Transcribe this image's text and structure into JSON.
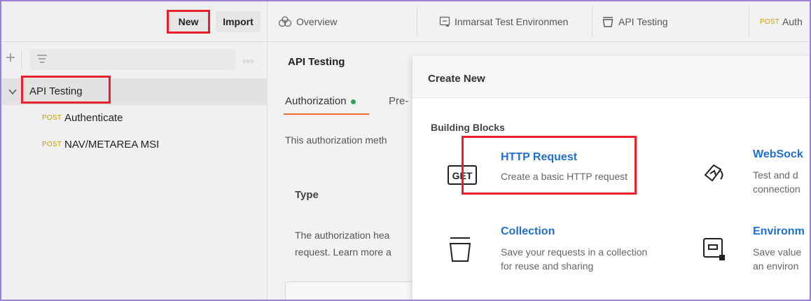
{
  "sidebar": {
    "new_label": "New",
    "import_label": "Import",
    "collection": "API Testing",
    "requests": [
      {
        "method": "POST",
        "name": "Authenticate"
      },
      {
        "method": "POST",
        "name": "NAV/METAREA MSI"
      }
    ]
  },
  "tabs": [
    {
      "label": "Overview",
      "icon": "overview-icon"
    },
    {
      "label": "Inmarsat Test Environmen",
      "icon": "environment-icon"
    },
    {
      "label": "API Testing",
      "icon": "collection-icon"
    },
    {
      "method": "POST",
      "label": "Auth"
    }
  ],
  "main": {
    "title": "API Testing",
    "auth_tab": "Authorization",
    "pre_tab": "Pre-",
    "auth_desc": "This authorization meth",
    "type_label": "Type",
    "auth_header_line1": "The authorization hea",
    "auth_header_line2": "request. Learn more a"
  },
  "modal": {
    "title": "Create New",
    "section": "Building Blocks",
    "blocks": [
      {
        "title": "HTTP Request",
        "desc1": "Create a basic HTTP request",
        "desc2": "",
        "icon": "get-icon",
        "icon_text": "GET"
      },
      {
        "title": "WebSock",
        "desc1": "Test and d",
        "desc2": "connection",
        "icon": "websocket-icon"
      },
      {
        "title": "Collection",
        "desc1": "Save your requests in a collection",
        "desc2": "for reuse and sharing",
        "icon": "collection-icon"
      },
      {
        "title": "Environm",
        "desc1": "Save value",
        "desc2": "an environ",
        "icon": "environment-icon"
      }
    ]
  },
  "colors": {
    "highlight": "#e8202a",
    "link": "#1f6fd1",
    "post_method": "#c8a000",
    "status_dot": "#2ea35c",
    "accent": "#f06a2b"
  }
}
